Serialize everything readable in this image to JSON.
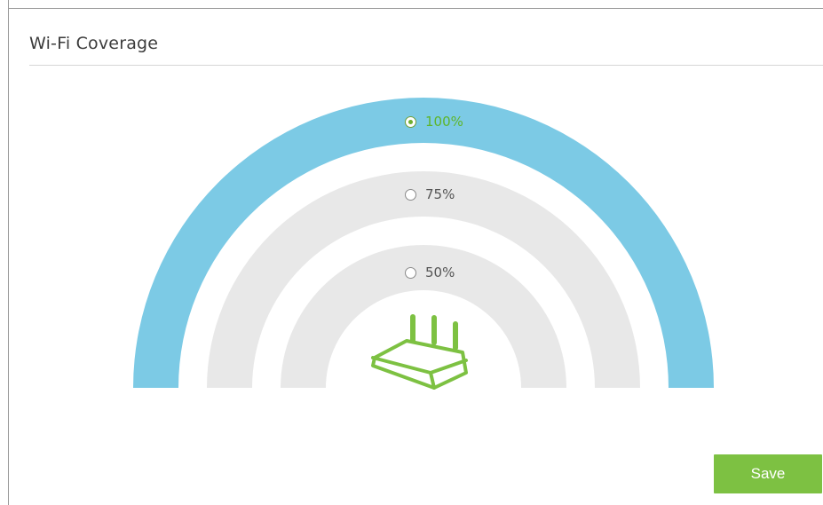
{
  "panel": {
    "title": "Wi-Fi Coverage"
  },
  "coverage": {
    "selected": "100%",
    "options": [
      {
        "label": "100%",
        "checked": true
      },
      {
        "label": "75%",
        "checked": false
      },
      {
        "label": "50%",
        "checked": false
      }
    ]
  },
  "actions": {
    "save_label": "Save"
  },
  "colors": {
    "outer_arc": "#7ccae5",
    "inner_arcs": "#e7e7e7",
    "accent_green": "#7dc142",
    "router_icon": "#7dc142"
  }
}
